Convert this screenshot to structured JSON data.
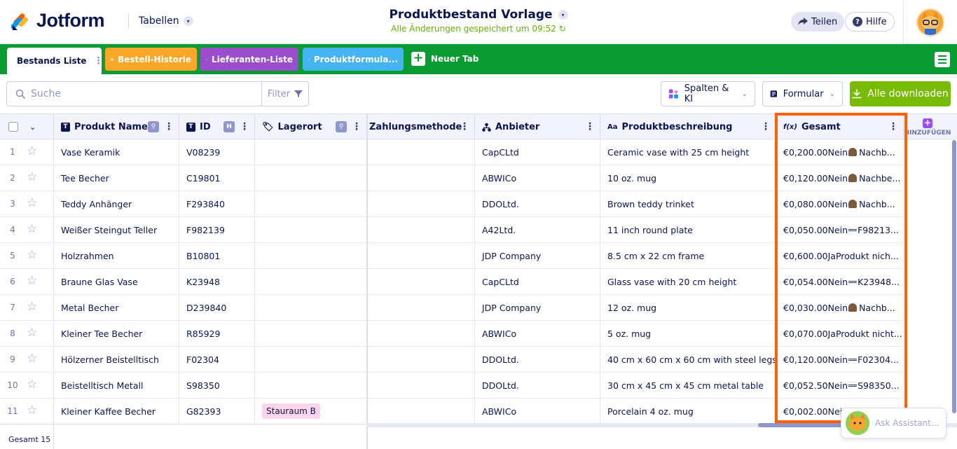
{
  "header": {
    "logo_text": "Jotform",
    "tables_label": "Tabellen",
    "title": "Produktbestand Vorlage",
    "saved_status": "Alle Änderungen gespeichert um 09:52",
    "share_label": "Teilen",
    "help_label": "Hilfe"
  },
  "tabs": [
    {
      "label": "Bestands Liste",
      "color": "#ffffff",
      "active": true
    },
    {
      "label": "Bestell-Historie",
      "color": "#f9a728"
    },
    {
      "label": "Lieferanten-Liste",
      "color": "#9b4ecb"
    },
    {
      "label": "Produktformula...",
      "color": "#44b4f2"
    }
  ],
  "new_tab_label": "Neuer Tab",
  "toolbar": {
    "search_placeholder": "Suche",
    "filter_label": "Filter",
    "columns_ai_label": "Spalten & KI",
    "form_label": "Formular",
    "download_label": "Alle downloaden"
  },
  "columns": [
    {
      "label": "Produkt Name",
      "icon": "text-icon"
    },
    {
      "label": "ID",
      "icon": "text-icon"
    },
    {
      "label": "Lagerort",
      "icon": "tag-icon"
    },
    {
      "label": "Zahlungsmethode",
      "icon": ""
    },
    {
      "label": "Anbieter",
      "icon": "hierarchy-icon"
    },
    {
      "label": "Produktbeschreibung",
      "icon": "long-text-icon"
    },
    {
      "label": "Gesamt",
      "icon": "formula-icon"
    }
  ],
  "add_column_label": "HINZUFÜGEN",
  "rows": [
    {
      "num": "1",
      "name": "Vase Keramik",
      "id": "V08239",
      "location": "",
      "payment": "",
      "vendor": "CapCLtd",
      "desc": "Ceramic vase with 25 cm height",
      "total": "€0,200.00Nein",
      "total_tail": "Nachb..."
    },
    {
      "num": "2",
      "name": "Tee Becher",
      "id": "C19801",
      "location": "",
      "payment": "",
      "vendor": "ABWICo",
      "desc": "10 oz. mug",
      "total": "€0,120.00Nein",
      "total_tail": "Nachbe..."
    },
    {
      "num": "3",
      "name": "Teddy Anhänger",
      "id": "F293840",
      "location": "",
      "payment": "",
      "vendor": "DDOLtd.",
      "desc": "Brown teddy trinket",
      "total": "€0,080.00Nein",
      "total_tail": "Nachb..."
    },
    {
      "num": "4",
      "name": "Weißer Steingut Teller",
      "id": "F982139",
      "location": "",
      "payment": "",
      "vendor": "A42Ltd.",
      "desc": "11 inch round plate",
      "total": "€0,050.00Nein",
      "total_tail": "F98213..."
    },
    {
      "num": "5",
      "name": "Holzrahmen",
      "id": "B10801",
      "location": "",
      "payment": "",
      "vendor": "JDP Company",
      "desc": "8.5 cm x 22 cm frame",
      "total": "€0,600.00JaProdukt nich...",
      "total_tail": ""
    },
    {
      "num": "6",
      "name": "Braune Glas Vase",
      "id": "K23948",
      "location": "",
      "payment": "",
      "vendor": "CapCLtd",
      "desc": "Glass vase with 20 cm height",
      "total": "€0,054.00Nein",
      "total_tail": "K23948..."
    },
    {
      "num": "7",
      "name": "Metal Becher",
      "id": "D239840",
      "location": "",
      "payment": "",
      "vendor": "JDP Company",
      "desc": "12 oz. mug",
      "total": "€0,030.00Nein",
      "total_tail": "Nachb..."
    },
    {
      "num": "8",
      "name": "Kleiner Tee Becher",
      "id": "R85929",
      "location": "",
      "payment": "",
      "vendor": "ABWICo",
      "desc": "5 oz. mug",
      "total": "€0,070.00JaProdukt nicht...",
      "total_tail": ""
    },
    {
      "num": "9",
      "name": "Hölzerner Beistelltisch",
      "id": "F02304",
      "location": "",
      "payment": "",
      "vendor": "DDOLtd.",
      "desc": "40 cm x 60 cm x 60 cm with steel legs",
      "total": "€0,120.00Nein",
      "total_tail": "F02304..."
    },
    {
      "num": "10",
      "name": "Beistelltisch Metall",
      "id": "S98350",
      "location": "",
      "payment": "",
      "vendor": "DDOLtd.",
      "desc": "30 cm x 45 cm x 45 cm metal table",
      "total": "€0,052.50Nein",
      "total_tail": "S98350..."
    },
    {
      "num": "11",
      "name": "Kleiner Kaffee Becher",
      "id": "G82393",
      "location": "Stauraum B",
      "payment": "",
      "vendor": "ABWICo",
      "desc": "Porcelain 4 oz. mug",
      "total": "€0,002.00Nein",
      "total_tail": ""
    }
  ],
  "footer": {
    "total_label": "Gesamt 15"
  },
  "assistant_label": "Ask Assistant..."
}
